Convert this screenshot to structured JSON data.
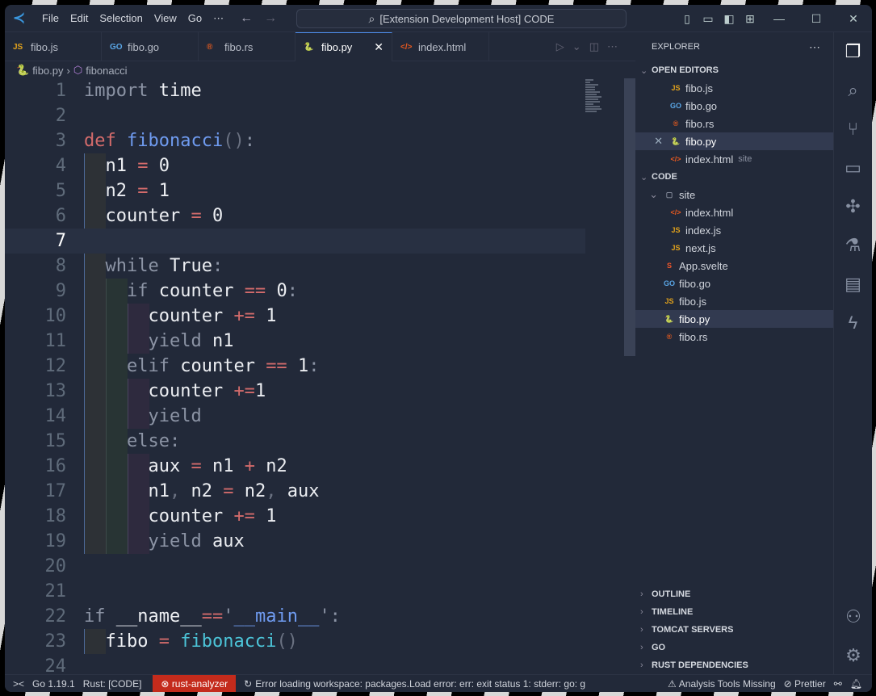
{
  "titlebar": {
    "menu": [
      "File",
      "Edit",
      "Selection",
      "View",
      "Go",
      "⋯"
    ],
    "command_center": "[Extension Development Host] CODE"
  },
  "tabs": [
    {
      "label": "fibo.js",
      "icon": "JS",
      "kind": "js"
    },
    {
      "label": "fibo.go",
      "icon": "GO",
      "kind": "go"
    },
    {
      "label": "fibo.rs",
      "icon": "®",
      "kind": "rs"
    },
    {
      "label": "fibo.py",
      "icon": "🐍",
      "kind": "py",
      "active": true
    },
    {
      "label": "index.html",
      "icon": "</>",
      "kind": "ht"
    }
  ],
  "breadcrumb": {
    "file": "fibo.py",
    "symbol": "fibonacci"
  },
  "code": [
    {
      "n": "1",
      "ind": 0,
      "tk": [
        [
          "kw",
          "import "
        ],
        [
          "id",
          "time"
        ]
      ]
    },
    {
      "n": "2",
      "ind": 0,
      "tk": []
    },
    {
      "n": "3",
      "ind": 0,
      "tk": [
        [
          "df",
          "def "
        ],
        [
          "fn",
          "fibonacci"
        ],
        [
          "pn",
          "()"
        ],
        [
          "kw",
          ":"
        ]
      ]
    },
    {
      "n": "4",
      "ind": 1,
      "tk": [
        [
          "id",
          "  n1 "
        ],
        [
          "op",
          "= "
        ],
        [
          "id",
          "0"
        ]
      ]
    },
    {
      "n": "5",
      "ind": 1,
      "tk": [
        [
          "id",
          "  n2 "
        ],
        [
          "op",
          "= "
        ],
        [
          "id",
          "1"
        ]
      ]
    },
    {
      "n": "6",
      "ind": 1,
      "tk": [
        [
          "id",
          "  counter "
        ],
        [
          "op",
          "= "
        ],
        [
          "id",
          "0"
        ]
      ]
    },
    {
      "n": "7",
      "ind": 0,
      "cur": true,
      "tk": []
    },
    {
      "n": "8",
      "ind": 1,
      "tk": [
        [
          "kw",
          "  while "
        ],
        [
          "id",
          "True"
        ],
        [
          "kw",
          ":"
        ]
      ]
    },
    {
      "n": "9",
      "ind": 2,
      "tk": [
        [
          "kw",
          "    if "
        ],
        [
          "id",
          "counter "
        ],
        [
          "op",
          "== "
        ],
        [
          "id",
          "0"
        ],
        [
          "kw",
          ":"
        ]
      ]
    },
    {
      "n": "10",
      "ind": 3,
      "tk": [
        [
          "id",
          "      counter "
        ],
        [
          "op",
          "+= "
        ],
        [
          "id",
          "1"
        ]
      ]
    },
    {
      "n": "11",
      "ind": 3,
      "tk": [
        [
          "kw",
          "      yield "
        ],
        [
          "id",
          "n1"
        ]
      ]
    },
    {
      "n": "12",
      "ind": 2,
      "tk": [
        [
          "kw",
          "    elif "
        ],
        [
          "id",
          "counter "
        ],
        [
          "op",
          "== "
        ],
        [
          "id",
          "1"
        ],
        [
          "kw",
          ":"
        ]
      ]
    },
    {
      "n": "13",
      "ind": 3,
      "tk": [
        [
          "id",
          "      counter "
        ],
        [
          "op",
          "+="
        ],
        [
          "id",
          "1"
        ]
      ]
    },
    {
      "n": "14",
      "ind": 3,
      "tk": [
        [
          "kw",
          "      yield"
        ]
      ]
    },
    {
      "n": "15",
      "ind": 2,
      "tk": [
        [
          "kw",
          "    else:"
        ]
      ]
    },
    {
      "n": "16",
      "ind": 3,
      "tk": [
        [
          "id",
          "      aux "
        ],
        [
          "op",
          "= "
        ],
        [
          "id",
          "n1 "
        ],
        [
          "op",
          "+ "
        ],
        [
          "id",
          "n2"
        ]
      ]
    },
    {
      "n": "17",
      "ind": 3,
      "tk": [
        [
          "id",
          "      n1"
        ],
        [
          "pn",
          ", "
        ],
        [
          "id",
          "n2 "
        ],
        [
          "op",
          "= "
        ],
        [
          "id",
          "n2"
        ],
        [
          "pn",
          ", "
        ],
        [
          "id",
          "aux"
        ]
      ]
    },
    {
      "n": "18",
      "ind": 3,
      "tk": [
        [
          "id",
          "      counter "
        ],
        [
          "op",
          "+= "
        ],
        [
          "id",
          "1"
        ]
      ]
    },
    {
      "n": "19",
      "ind": 3,
      "tk": [
        [
          "kw",
          "      yield "
        ],
        [
          "id",
          "aux"
        ]
      ]
    },
    {
      "n": "20",
      "ind": 0,
      "tk": []
    },
    {
      "n": "21",
      "ind": 0,
      "tk": []
    },
    {
      "n": "22",
      "ind": 0,
      "tk": [
        [
          "kw",
          "if "
        ],
        [
          "id",
          "__name__"
        ],
        [
          "op",
          "=="
        ],
        [
          "kw",
          "'"
        ],
        [
          "st",
          "__main__"
        ],
        [
          "kw",
          "':"
        ]
      ]
    },
    {
      "n": "23",
      "ind": 1,
      "tk": [
        [
          "id",
          "  fibo "
        ],
        [
          "op",
          "= "
        ],
        [
          "bi",
          "fibonacci"
        ],
        [
          "pn",
          "()"
        ]
      ]
    },
    {
      "n": "24",
      "ind": 0,
      "tk": []
    }
  ],
  "explorer": {
    "title": "EXPLORER",
    "open_editors_label": "OPEN EDITORS",
    "open_editors": [
      {
        "label": "fibo.js",
        "icon": "JS",
        "kind": "js"
      },
      {
        "label": "fibo.go",
        "icon": "GO",
        "kind": "go"
      },
      {
        "label": "fibo.rs",
        "icon": "®",
        "kind": "rs"
      },
      {
        "label": "fibo.py",
        "icon": "🐍",
        "kind": "py",
        "active": true
      },
      {
        "label": "index.html",
        "icon": "</>",
        "kind": "ht",
        "desc": "site"
      }
    ],
    "folder_label": "CODE",
    "tree": [
      {
        "label": "site",
        "kind": "fo",
        "icon": "▢",
        "depth": 1,
        "folder": true
      },
      {
        "label": "index.html",
        "icon": "</>",
        "kind": "ht",
        "depth": 2
      },
      {
        "label": "index.js",
        "icon": "JS",
        "kind": "js",
        "depth": 2
      },
      {
        "label": "next.js",
        "icon": "JS",
        "kind": "js",
        "depth": 2
      },
      {
        "label": "App.svelte",
        "icon": "S",
        "kind": "sv",
        "depth": 1
      },
      {
        "label": "fibo.go",
        "icon": "GO",
        "kind": "go",
        "depth": 1
      },
      {
        "label": "fibo.js",
        "icon": "JS",
        "kind": "js",
        "depth": 1
      },
      {
        "label": "fibo.py",
        "icon": "🐍",
        "kind": "py",
        "depth": 1,
        "active": true
      },
      {
        "label": "fibo.rs",
        "icon": "®",
        "kind": "rs",
        "depth": 1
      }
    ],
    "bottom_sections": [
      "OUTLINE",
      "TIMELINE",
      "TOMCAT SERVERS",
      "GO",
      "RUST DEPENDENCIES"
    ]
  },
  "status": {
    "remote": "><",
    "go": "Go 1.19.1",
    "rust": "Rust: [CODE]",
    "error_badge": "rust-analyzer",
    "message": "Error loading workspace: packages.Load error: err: exit status 1: stderr: go: g",
    "analysis": "Analysis Tools Missing",
    "prettier": "Prettier"
  }
}
